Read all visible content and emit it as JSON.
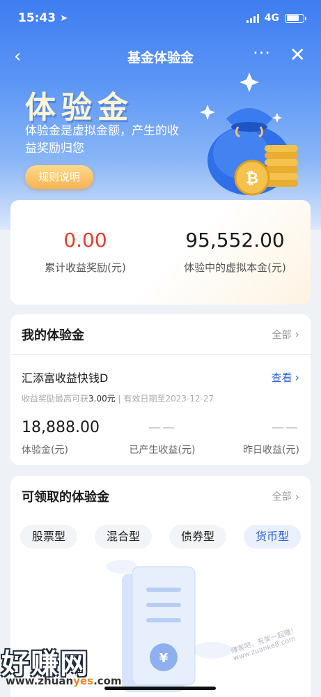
{
  "status": {
    "time": "15:43",
    "network": "4G"
  },
  "nav": {
    "title": "基金体验金",
    "back": "‹",
    "more": "···",
    "close": "✕"
  },
  "hero": {
    "title": "体验金",
    "desc": "体验金是虚拟金额，产生的收益奖励归您",
    "rules_button": "规则说明"
  },
  "summary": {
    "earned_value": "0.00",
    "earned_label": "累计收益奖励(元)",
    "principal_value": "95,552.00",
    "principal_label": "体验中的虚拟本金(元)"
  },
  "my_card": {
    "title": "我的体验金",
    "all_link": "全部",
    "fund_name": "汇添富收益快钱D",
    "view_link": "查看",
    "note_prefix": "收益奖励最高可获",
    "note_amount": "3.00元",
    "note_sep": "|",
    "note_expiry": "有效日期至2023-12-27",
    "stats": [
      {
        "value": "18,888.00",
        "label": "体验金(元)"
      },
      {
        "value": "——",
        "label": "已产生收益(元)"
      },
      {
        "value": "——",
        "label": "昨日收益(元)"
      }
    ]
  },
  "avail_card": {
    "title": "可领取的体验金",
    "all_link": "全部",
    "chips": [
      "股票型",
      "混合型",
      "债券型",
      "货币型"
    ],
    "active_chip": 3
  },
  "watermark": {
    "brand": "好赚网",
    "url_prefix": "www.zhuan",
    "url_mid": "yes",
    "url_suffix": ".com",
    "side": "赚客吧，有奖一起赚！www.zuanke8.com"
  },
  "colors": {
    "primary": "#2b63d9",
    "red": "#e33d2e",
    "gold": "#f5b453"
  }
}
